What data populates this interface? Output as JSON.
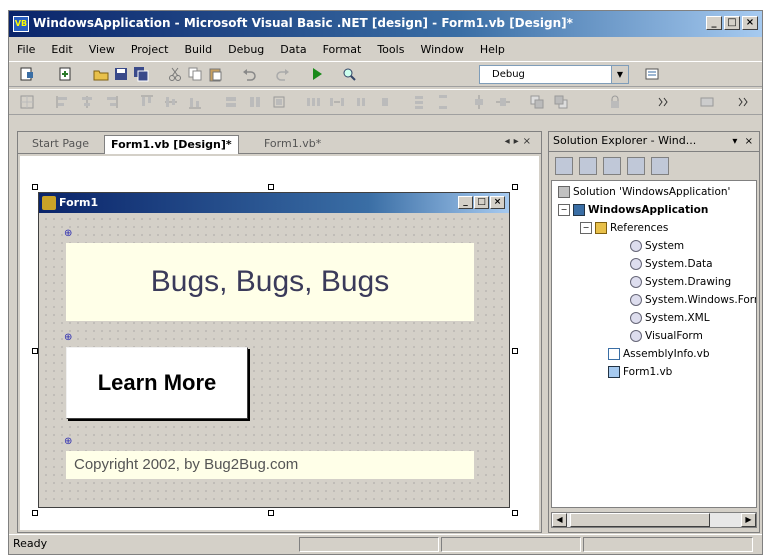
{
  "window": {
    "title": "WindowsApplication - Microsoft Visual Basic .NET [design] - Form1.vb [Design]*",
    "app_icon_text": "VB"
  },
  "menu": [
    "File",
    "Edit",
    "View",
    "Project",
    "Build",
    "Debug",
    "Data",
    "Format",
    "Tools",
    "Window",
    "Help"
  ],
  "toolbar": {
    "config_value": "Debug"
  },
  "tabs": {
    "start_page": "Start Page",
    "design": "Form1.vb [Design]*",
    "code": "Form1.vb*"
  },
  "form": {
    "title": "Form1",
    "bugs_label": "Bugs, Bugs, Bugs",
    "learn_button": "Learn More",
    "copyright_label": "Copyright 2002, by Bug2Bug.com"
  },
  "solution_explorer": {
    "title": "Solution Explorer - Wind...",
    "nodes": {
      "solution": "Solution 'WindowsApplication'",
      "project": "WindowsApplication",
      "references": "References",
      "ref_system": "System",
      "ref_data": "System.Data",
      "ref_drawing": "System.Drawing",
      "ref_windows": "System.Windows.Forms",
      "ref_xml": "System.XML",
      "ref_visualform": "VisualForm",
      "assemblyinfo": "AssemblyInfo.vb",
      "form1": "Form1.vb"
    }
  },
  "status": {
    "text": "Ready"
  },
  "colors": {
    "title_active": "#0a246a",
    "chrome": "#d4d0c8",
    "label_bg": "#ffffe8"
  }
}
